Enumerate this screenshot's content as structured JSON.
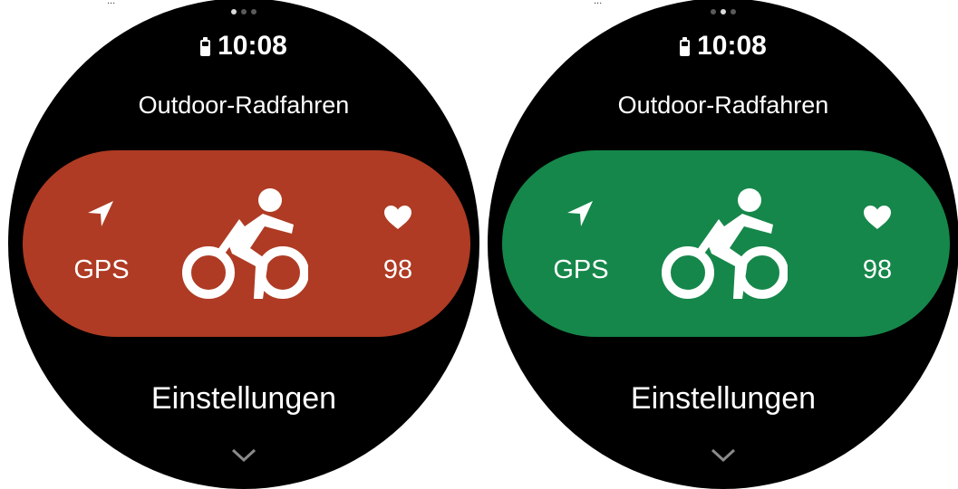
{
  "top_fragment": {
    "left_text": "...",
    "right_text": "..."
  },
  "watches": [
    {
      "theme": "not-ready",
      "status": {
        "time": "10:08"
      },
      "activity_title": "Outdoor-Radfahren",
      "pill_color": "#af3b24",
      "gps_label": "GPS",
      "heart_rate": "98",
      "settings_label": "Einstellungen",
      "page_indicator": {
        "count": 3,
        "active_index": 0
      }
    },
    {
      "theme": "ready",
      "status": {
        "time": "10:08"
      },
      "activity_title": "Outdoor-Radfahren",
      "pill_color": "#15874a",
      "gps_label": "GPS",
      "heart_rate": "98",
      "settings_label": "Einstellungen",
      "page_indicator": {
        "count": 3,
        "active_index": 1
      }
    }
  ],
  "icons": {
    "battery": "battery-icon",
    "navigation": "navigation-arrow-icon",
    "activity": "bicycle-icon",
    "heart": "heart-icon",
    "more": "chevron-down-icon"
  }
}
